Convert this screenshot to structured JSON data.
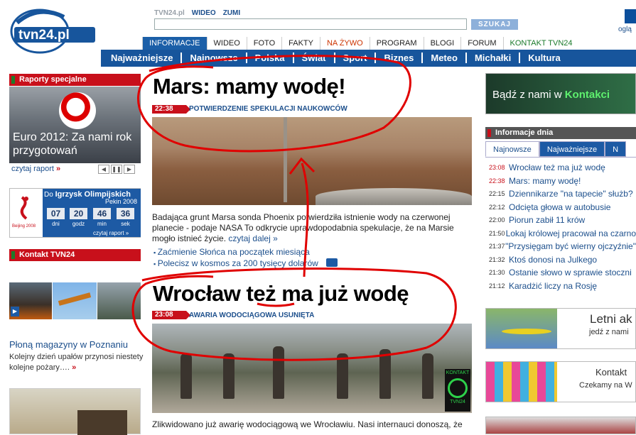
{
  "header": {
    "logo_text": "tvn24.pl",
    "top_links": [
      "TVN24.pl",
      "WIDEO",
      "ZUMI"
    ],
    "search_placeholder": "",
    "search_button": "SZUKAJ",
    "corner_text": "oglą"
  },
  "main_nav": [
    {
      "label": "INFORMACJE",
      "active": true
    },
    {
      "label": "WIDEO"
    },
    {
      "label": "FOTO"
    },
    {
      "label": "FAKTY"
    },
    {
      "label": "NA ŻYWO",
      "live": true
    },
    {
      "label": "PROGRAM"
    },
    {
      "label": "BLOGI"
    },
    {
      "label": "FORUM"
    },
    {
      "label": "KONTAKT TVN24",
      "kontakt": true
    }
  ],
  "sub_nav": [
    "Najważniejsze",
    "Najnowsze",
    "Polska",
    "Świat",
    "Sport",
    "Biznes",
    "Meteo",
    "Michałki",
    "Kultura"
  ],
  "left": {
    "raporty_header": "Raporty specjalne",
    "raporty_caption": "Euro 2012: Za nami rok przygotowań",
    "raporty_link": "czytaj raport",
    "raporty_link_arrow": "»",
    "olymp_title_pre": "Do",
    "olymp_title": "Igrzysk Olimpijskich",
    "olymp_sub": "Pekin 2008",
    "olymp_logo_text": "Beijing 2008",
    "countdown": [
      {
        "value": "07",
        "label": "dni"
      },
      {
        "value": "20",
        "label": "godz"
      },
      {
        "value": "46",
        "label": "min"
      },
      {
        "value": "36",
        "label": "sek"
      }
    ],
    "olymp_link": "czytaj raport »",
    "kontakt_header": "Kontakt TVN24",
    "kontakt_headline": "Płoną magazyny w Poznaniu",
    "kontakt_desc": "Kolejny dzień upałów przynosi niestety kolejne pożary….",
    "kontakt_desc_arrow": "»"
  },
  "articles": [
    {
      "headline": "Mars: mamy wodę!",
      "time": "22:38",
      "subhead": "POTWIERDZENIE SPEKULACJI NAUKOWCÓW",
      "lead": "Badająca grunt Marsa sonda Phoenix potwierdziła istnienie wody na czerwonej planecie - podaje NASA To odkrycie uprawdopodabnia spekulacje, że na Marsie mogło istnieć życie.",
      "more": "czytaj dalej »",
      "related": [
        "Zaćmienie Słońca na początek miesiąca",
        "Polecisz w kosmos za 200 tysięcy dolarów"
      ]
    },
    {
      "headline": "Wrocław też ma już wodę",
      "time": "23:08",
      "subhead": "AWARIA WODOCIĄGOWA USUNIĘTA",
      "lead": "Zlikwidowano już awarię wodociągową we Wrocławiu. Nasi internauci donoszą, że",
      "logo_top": "KONTAKT",
      "logo_bottom": "TVN24"
    }
  ],
  "right": {
    "banner_pre": "Bądź z nami w",
    "banner_highlight": "Kontakci",
    "info_header": "Informacje dnia",
    "tabs": [
      "Najnowsze",
      "Najważniejsze",
      "N"
    ],
    "news": [
      {
        "time": "23:08",
        "title": "Wrocław też ma już wodę",
        "hot": true
      },
      {
        "time": "22:38",
        "title": "Mars: mamy wodę!",
        "hot": true
      },
      {
        "time": "22:15",
        "title": "Dziennikarze \"na tapecie\" służb?"
      },
      {
        "time": "22:12",
        "title": "Odcięta głowa w autobusie"
      },
      {
        "time": "22:00",
        "title": "Piorun zabił 11 krów"
      },
      {
        "time": "21:50",
        "title": "Lokaj królowej pracował na czarno"
      },
      {
        "time": "21:37",
        "title": "\"Przysięgam być wierny ojczyźnie\""
      },
      {
        "time": "21:32",
        "title": "Ktoś donosi na Julkego"
      },
      {
        "time": "21:30",
        "title": "Ostanie słowo w sprawie stoczni"
      },
      {
        "time": "21:12",
        "title": "Karadżić liczy na Rosję"
      }
    ],
    "promo1_title": "Letni ak",
    "promo1_sub": "jedź z nami",
    "promo2_title": "Kontakt",
    "promo2_sub": "Czekamy na W"
  },
  "colors": {
    "brand_blue": "#17559c",
    "brand_red": "#c8101b",
    "annotation_red": "#e00000"
  }
}
